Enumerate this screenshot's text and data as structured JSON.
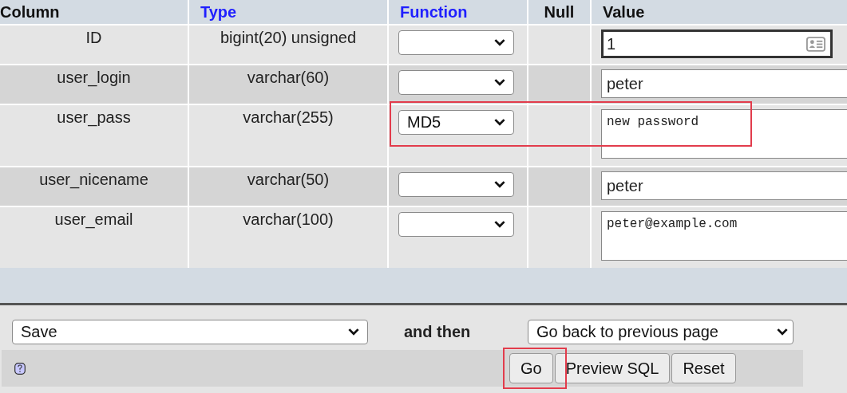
{
  "table": {
    "columns": [
      {
        "label": "Column",
        "kind": "plain"
      },
      {
        "label": "Type",
        "kind": "link"
      },
      {
        "label": "Function",
        "kind": "link"
      },
      {
        "label": "Null",
        "kind": "plain"
      },
      {
        "label": "Value",
        "kind": "plain"
      }
    ],
    "rows": [
      {
        "column": "ID",
        "type": "bigint(20) unsigned",
        "function": "",
        "value": "1",
        "kind": "input",
        "focused": true,
        "highlighted": false
      },
      {
        "column": "user_login",
        "type": "varchar(60)",
        "function": "",
        "value": "peter",
        "kind": "input",
        "focused": false,
        "highlighted": false
      },
      {
        "column": "user_pass",
        "type": "varchar(255)",
        "function": "MD5",
        "value": "new password",
        "kind": "textarea",
        "focused": false,
        "highlighted": true
      },
      {
        "column": "user_nicename",
        "type": "varchar(50)",
        "function": "",
        "value": "peter",
        "kind": "input",
        "focused": false,
        "highlighted": false
      },
      {
        "column": "user_email",
        "type": "varchar(100)",
        "function": "",
        "value": "peter@example.com",
        "kind": "textarea",
        "focused": false,
        "highlighted": false
      }
    ]
  },
  "footer": {
    "action": "Save",
    "and_then_label": "and then",
    "after": "Go back to previous page",
    "buttons": [
      {
        "label": "Go",
        "highlighted": true
      },
      {
        "label": "Preview SQL",
        "highlighted": false
      },
      {
        "label": "Reset",
        "highlighted": false
      }
    ]
  }
}
